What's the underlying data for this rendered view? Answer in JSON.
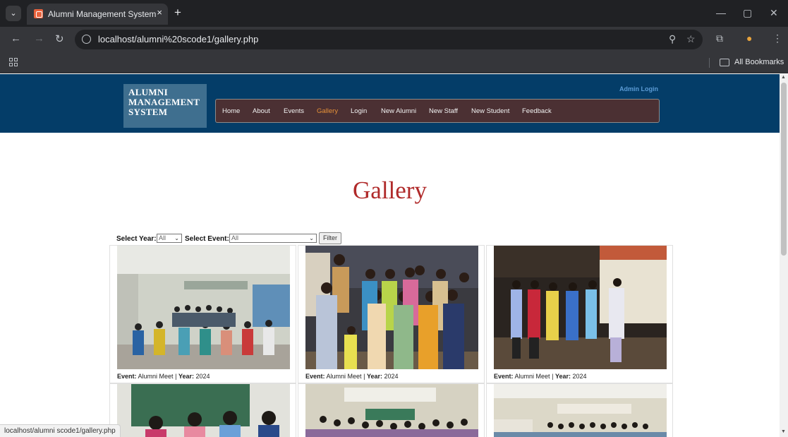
{
  "browser": {
    "tab_title": "Alumni Management System",
    "tab_close": "×",
    "new_tab": "+",
    "url": "localhost/alumni%20scode1/gallery.php",
    "bookmarks_label": "All Bookmarks",
    "status_url": "localhost/alumni scode1/gallery.php",
    "icons": [
      "tab-list-icon",
      "back-icon",
      "forward-icon",
      "reload-icon",
      "site-info-icon",
      "zoom-icon",
      "star-icon",
      "extensions-icon",
      "profile-icon",
      "menu-icon",
      "apps-icon",
      "folder-icon",
      "minimize-icon",
      "restore-icon",
      "close-icon"
    ]
  },
  "site": {
    "logo_lines": [
      "ALUMNI",
      "MANAGEMENT",
      "SYSTEM"
    ],
    "admin_login": "Admin Login",
    "nav": [
      "Home",
      "About",
      "Events",
      "Gallery",
      "Login",
      "New Alumni",
      "New Staff",
      "New Student",
      "Feedback"
    ],
    "active_nav": "Gallery",
    "colors": {
      "header": "#043d68",
      "navbar": "#4b3033",
      "active": "#e69138",
      "title": "#b02a2a"
    }
  },
  "gallery": {
    "title": "Gallery",
    "select_year_label": "Select Year:",
    "select_year_value": "All",
    "select_event_label": "Select Event:",
    "select_event_value": "All",
    "filter_button": "Filter",
    "event_label": "Event:",
    "year_label": "Year:",
    "separator": "|",
    "cards": [
      {
        "event": "Alumni Meet",
        "year": "2024"
      },
      {
        "event": "Alumni Meet",
        "year": "2024"
      },
      {
        "event": "Alumni Meet",
        "year": "2024"
      },
      {
        "event": "",
        "year": ""
      },
      {
        "event": "",
        "year": ""
      },
      {
        "event": "",
        "year": ""
      }
    ]
  }
}
